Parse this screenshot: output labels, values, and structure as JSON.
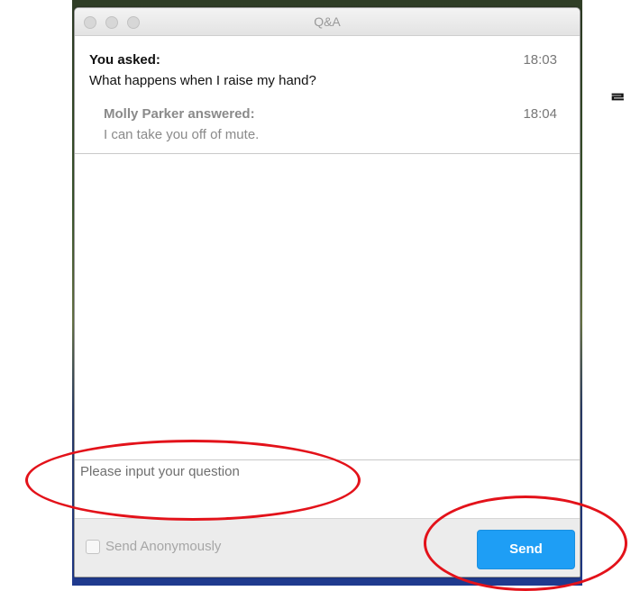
{
  "window": {
    "title": "Q&A"
  },
  "messages": {
    "question": {
      "header": "You asked:",
      "time": "18:03",
      "text": "What happens when I raise my hand?"
    },
    "answer": {
      "header": "Molly Parker answered:",
      "time": "18:04",
      "text": "I can take you off of mute."
    }
  },
  "input": {
    "placeholder": "Please input your question",
    "value": ""
  },
  "footer": {
    "anonymous_label": "Send Anonymously",
    "anonymous_checked": false,
    "send_label": "Send"
  },
  "side_glyph": "ᄅ",
  "colors": {
    "send_button": "#1e9ef5",
    "annotation": "#e3121a"
  }
}
